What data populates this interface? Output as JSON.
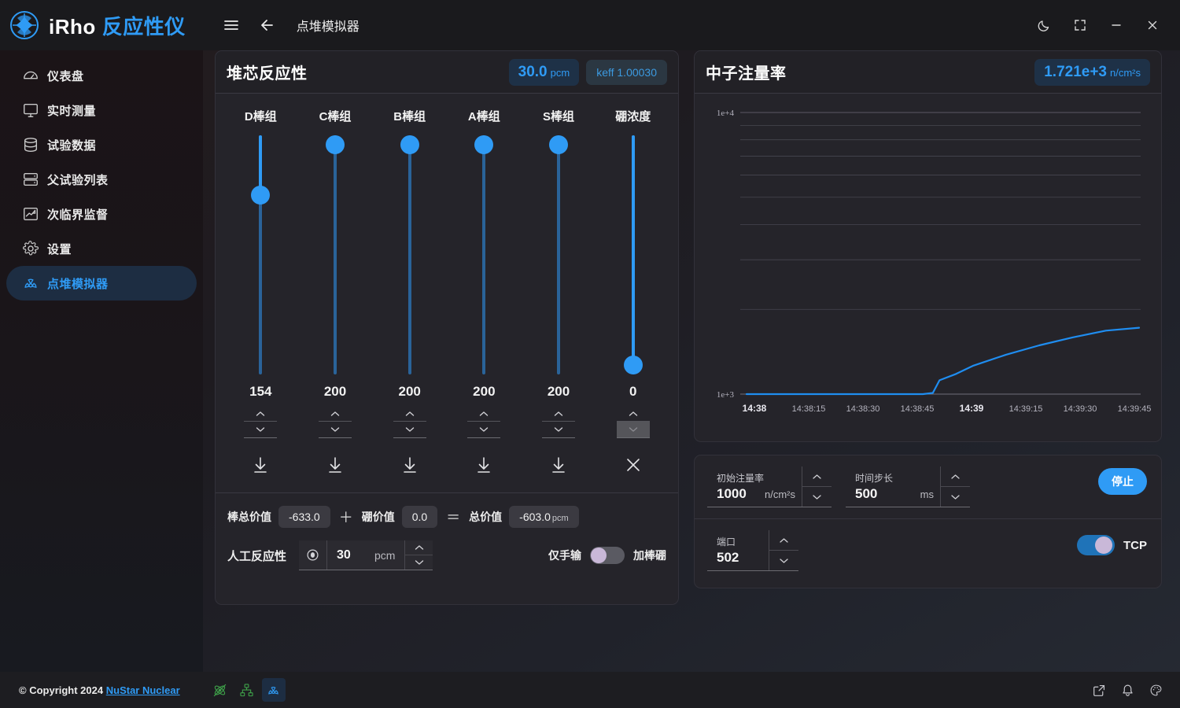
{
  "app": {
    "brand_latin": "iRho",
    "brand_cn": "反应性仪",
    "page_title": "点堆模拟器"
  },
  "titlebar": {
    "menu_icon": "hamburger-icon",
    "back_icon": "arrow-left-icon",
    "dark_mode_icon": "moon-icon",
    "fullscreen_icon": "expand-icon",
    "minimize_icon": "minimize-icon",
    "close_icon": "close-icon"
  },
  "sidebar": {
    "items": [
      {
        "label": "仪表盘",
        "icon": "gauge-icon",
        "active": false
      },
      {
        "label": "实时测量",
        "icon": "monitor-icon",
        "active": false
      },
      {
        "label": "试验数据",
        "icon": "database-icon",
        "active": false
      },
      {
        "label": "父试验列表",
        "icon": "server-icon",
        "active": false
      },
      {
        "label": "次临界监督",
        "icon": "line-chart-icon",
        "active": false
      },
      {
        "label": "设置",
        "icon": "gear-icon",
        "active": false
      },
      {
        "label": "点堆模拟器",
        "icon": "radiation-icon",
        "active": true
      }
    ]
  },
  "reactivity": {
    "title": "堆芯反应性",
    "pcm_value": "30.0",
    "pcm_unit": "pcm",
    "keff_badge": "keff 1.00030",
    "columns": [
      {
        "label": "D棒组",
        "value": "154",
        "percent": 77,
        "action_icon": "insert-down-icon",
        "down_disabled": false
      },
      {
        "label": "C棒组",
        "value": "200",
        "percent": 100,
        "action_icon": "insert-down-icon",
        "down_disabled": false
      },
      {
        "label": "B棒组",
        "value": "200",
        "percent": 100,
        "action_icon": "insert-down-icon",
        "down_disabled": false
      },
      {
        "label": "A棒组",
        "value": "200",
        "percent": 100,
        "action_icon": "insert-down-icon",
        "down_disabled": false
      },
      {
        "label": "S棒组",
        "value": "200",
        "percent": 100,
        "action_icon": "insert-down-icon",
        "down_disabled": false
      },
      {
        "label": "硼浓度",
        "value": "0",
        "percent": 0,
        "action_icon": "clear-x-icon",
        "down_disabled": true
      }
    ],
    "summary": {
      "rod_label": "棒总价值",
      "rod_value": "-633.0",
      "plus": "＋",
      "boron_label": "硼价值",
      "boron_value": "0.0",
      "equals": "＝",
      "total_label": "总价值",
      "total_value": "-603.0",
      "total_unit": "pcm"
    },
    "manual": {
      "label": "人工反应性",
      "icon": "target-icon",
      "value": "30",
      "unit": "pcm",
      "toggle_left_label": "仅手输",
      "toggle_right_label": "加棒硼",
      "toggle_on": false
    }
  },
  "flux": {
    "title": "中子注量率",
    "badge_value": "1.721e+3",
    "badge_unit": "n/cm²s"
  },
  "chart_data": {
    "type": "line",
    "title": "中子注量率",
    "xlabel": "",
    "ylabel": "",
    "yscale": "log",
    "ylim": [
      1000,
      10000
    ],
    "ytick_labels": [
      "1e+4",
      "1e+3"
    ],
    "xtick_labels": [
      "14:38",
      "14:38:15",
      "14:38:30",
      "14:38:45",
      "14:39",
      "14:39:15",
      "14:39:30",
      "14:39:45"
    ],
    "xtick_bold": [
      true,
      false,
      false,
      false,
      true,
      false,
      false,
      false
    ],
    "grid": true,
    "legend": "none",
    "line_color": "#1f8df0",
    "series": [
      {
        "name": "neutron flux",
        "x": [
          "14:37:52",
          "14:38:00",
          "14:38:15",
          "14:38:30",
          "14:38:45",
          "14:38:48",
          "14:38:50",
          "14:38:55",
          "14:39:00",
          "14:39:10",
          "14:39:20",
          "14:39:30",
          "14:39:40",
          "14:39:50"
        ],
        "values": [
          1000,
          1000,
          1000,
          1000,
          1000,
          1010,
          1120,
          1180,
          1260,
          1380,
          1490,
          1590,
          1680,
          1721
        ]
      }
    ]
  },
  "controls": {
    "initial_flux": {
      "label": "初始注量率",
      "value": "1000",
      "unit": "n/cm²s"
    },
    "time_step": {
      "label": "时间步长",
      "value": "500",
      "unit": "ms"
    },
    "port": {
      "label": "端口",
      "value": "502"
    },
    "stop_button": "停止",
    "tcp_label": "TCP",
    "tcp_on": true
  },
  "footer": {
    "copyright": "© Copyright 2024",
    "company": "NuStar Nuclear",
    "status_icons": [
      {
        "name": "atom-disconnected-icon",
        "color": "#3fa34a",
        "selected": false
      },
      {
        "name": "network-icon",
        "color": "#3fa34a",
        "selected": false
      },
      {
        "name": "radiation-icon",
        "color": "#2f9bf5",
        "selected": true
      }
    ],
    "right_icons": [
      "external-link-icon",
      "bell-icon",
      "palette-icon"
    ]
  }
}
